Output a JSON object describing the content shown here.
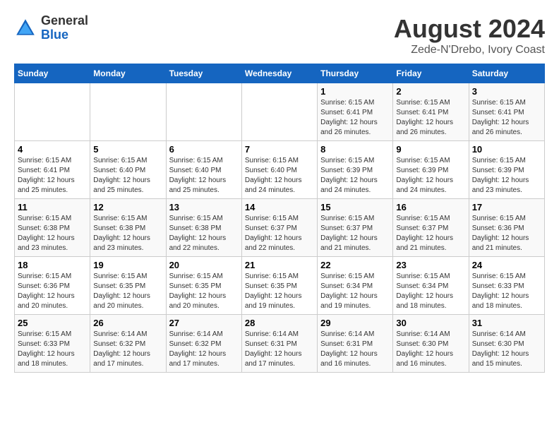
{
  "header": {
    "logo_line1": "General",
    "logo_line2": "Blue",
    "title": "August 2024",
    "subtitle": "Zede-N'Drebo, Ivory Coast"
  },
  "days_of_week": [
    "Sunday",
    "Monday",
    "Tuesday",
    "Wednesday",
    "Thursday",
    "Friday",
    "Saturday"
  ],
  "weeks": [
    [
      {
        "day": "",
        "info": ""
      },
      {
        "day": "",
        "info": ""
      },
      {
        "day": "",
        "info": ""
      },
      {
        "day": "",
        "info": ""
      },
      {
        "day": "1",
        "info": "Sunrise: 6:15 AM\nSunset: 6:41 PM\nDaylight: 12 hours\nand 26 minutes."
      },
      {
        "day": "2",
        "info": "Sunrise: 6:15 AM\nSunset: 6:41 PM\nDaylight: 12 hours\nand 26 minutes."
      },
      {
        "day": "3",
        "info": "Sunrise: 6:15 AM\nSunset: 6:41 PM\nDaylight: 12 hours\nand 26 minutes."
      }
    ],
    [
      {
        "day": "4",
        "info": "Sunrise: 6:15 AM\nSunset: 6:41 PM\nDaylight: 12 hours\nand 25 minutes."
      },
      {
        "day": "5",
        "info": "Sunrise: 6:15 AM\nSunset: 6:40 PM\nDaylight: 12 hours\nand 25 minutes."
      },
      {
        "day": "6",
        "info": "Sunrise: 6:15 AM\nSunset: 6:40 PM\nDaylight: 12 hours\nand 25 minutes."
      },
      {
        "day": "7",
        "info": "Sunrise: 6:15 AM\nSunset: 6:40 PM\nDaylight: 12 hours\nand 24 minutes."
      },
      {
        "day": "8",
        "info": "Sunrise: 6:15 AM\nSunset: 6:39 PM\nDaylight: 12 hours\nand 24 minutes."
      },
      {
        "day": "9",
        "info": "Sunrise: 6:15 AM\nSunset: 6:39 PM\nDaylight: 12 hours\nand 24 minutes."
      },
      {
        "day": "10",
        "info": "Sunrise: 6:15 AM\nSunset: 6:39 PM\nDaylight: 12 hours\nand 23 minutes."
      }
    ],
    [
      {
        "day": "11",
        "info": "Sunrise: 6:15 AM\nSunset: 6:38 PM\nDaylight: 12 hours\nand 23 minutes."
      },
      {
        "day": "12",
        "info": "Sunrise: 6:15 AM\nSunset: 6:38 PM\nDaylight: 12 hours\nand 23 minutes."
      },
      {
        "day": "13",
        "info": "Sunrise: 6:15 AM\nSunset: 6:38 PM\nDaylight: 12 hours\nand 22 minutes."
      },
      {
        "day": "14",
        "info": "Sunrise: 6:15 AM\nSunset: 6:37 PM\nDaylight: 12 hours\nand 22 minutes."
      },
      {
        "day": "15",
        "info": "Sunrise: 6:15 AM\nSunset: 6:37 PM\nDaylight: 12 hours\nand 21 minutes."
      },
      {
        "day": "16",
        "info": "Sunrise: 6:15 AM\nSunset: 6:37 PM\nDaylight: 12 hours\nand 21 minutes."
      },
      {
        "day": "17",
        "info": "Sunrise: 6:15 AM\nSunset: 6:36 PM\nDaylight: 12 hours\nand 21 minutes."
      }
    ],
    [
      {
        "day": "18",
        "info": "Sunrise: 6:15 AM\nSunset: 6:36 PM\nDaylight: 12 hours\nand 20 minutes."
      },
      {
        "day": "19",
        "info": "Sunrise: 6:15 AM\nSunset: 6:35 PM\nDaylight: 12 hours\nand 20 minutes."
      },
      {
        "day": "20",
        "info": "Sunrise: 6:15 AM\nSunset: 6:35 PM\nDaylight: 12 hours\nand 20 minutes."
      },
      {
        "day": "21",
        "info": "Sunrise: 6:15 AM\nSunset: 6:35 PM\nDaylight: 12 hours\nand 19 minutes."
      },
      {
        "day": "22",
        "info": "Sunrise: 6:15 AM\nSunset: 6:34 PM\nDaylight: 12 hours\nand 19 minutes."
      },
      {
        "day": "23",
        "info": "Sunrise: 6:15 AM\nSunset: 6:34 PM\nDaylight: 12 hours\nand 18 minutes."
      },
      {
        "day": "24",
        "info": "Sunrise: 6:15 AM\nSunset: 6:33 PM\nDaylight: 12 hours\nand 18 minutes."
      }
    ],
    [
      {
        "day": "25",
        "info": "Sunrise: 6:15 AM\nSunset: 6:33 PM\nDaylight: 12 hours\nand 18 minutes."
      },
      {
        "day": "26",
        "info": "Sunrise: 6:14 AM\nSunset: 6:32 PM\nDaylight: 12 hours\nand 17 minutes."
      },
      {
        "day": "27",
        "info": "Sunrise: 6:14 AM\nSunset: 6:32 PM\nDaylight: 12 hours\nand 17 minutes."
      },
      {
        "day": "28",
        "info": "Sunrise: 6:14 AM\nSunset: 6:31 PM\nDaylight: 12 hours\nand 17 minutes."
      },
      {
        "day": "29",
        "info": "Sunrise: 6:14 AM\nSunset: 6:31 PM\nDaylight: 12 hours\nand 16 minutes."
      },
      {
        "day": "30",
        "info": "Sunrise: 6:14 AM\nSunset: 6:30 PM\nDaylight: 12 hours\nand 16 minutes."
      },
      {
        "day": "31",
        "info": "Sunrise: 6:14 AM\nSunset: 6:30 PM\nDaylight: 12 hours\nand 15 minutes."
      }
    ]
  ]
}
